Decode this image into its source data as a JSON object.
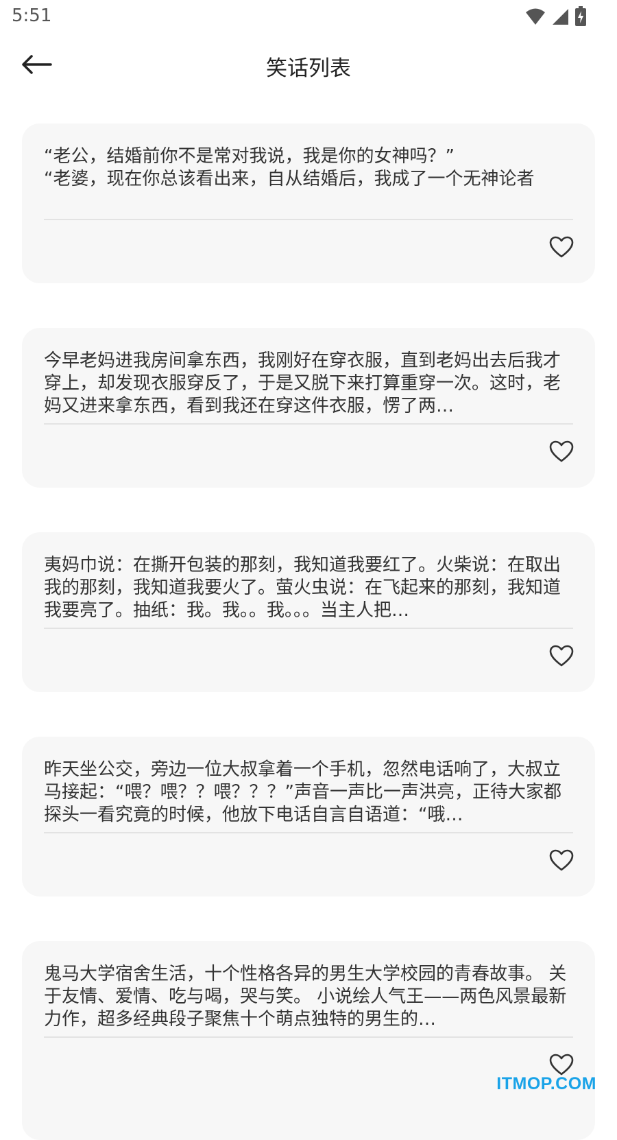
{
  "status_bar": {
    "time": "5:51",
    "icons": [
      "wifi-icon",
      "cellular-signal-icon",
      "battery-charging-icon"
    ]
  },
  "app_bar": {
    "back_icon": "arrow-left-icon",
    "title": "笑话列表"
  },
  "jokes": [
    {
      "text": "“老公，结婚前你不是常对我说，我是你的女神吗？”\n“老婆，现在你总该看出来，自从结婚后，我成了一个无神论者",
      "favorite_icon": "heart-outline-icon"
    },
    {
      "text": "今早老妈进我房间拿东西，我刚好在穿衣服，直到老妈出去后我才穿上，却发现衣服穿反了，于是又脱下来打算重穿一次。这时，老妈又进来拿东西，看到我还在穿这件衣服，愣了两…",
      "favorite_icon": "heart-outline-icon"
    },
    {
      "text": "夷妈巾说：在撕开包装的那刻，我知道我要红了。火柴说：在取出我的那刻，我知道我要火了。萤火虫说：在飞起来的那刻，我知道我要亮了。抽纸：我。我。。我。。。当主人把…",
      "favorite_icon": "heart-outline-icon"
    },
    {
      "text": "昨天坐公交，旁边一位大叔拿着一个手机，忽然电话响了，大叔立马接起：“喂？喂？？喂？？？”声音一声比一声洪亮，正待大家都探头一看究竟的时候，他放下电话自言自语道：“哦…",
      "favorite_icon": "heart-outline-icon"
    },
    {
      "text": "鬼马大学宿舍生活，十个性格各异的男生大学校园的青春故事。 关于友情、爱情、吃与喝，哭与笑。 小说绘人气王——两色风景最新力作，超多经典段子聚焦十个萌点独特的男生的…",
      "favorite_icon": "heart-outline-icon"
    }
  ],
  "watermark": "ITMOP.COM",
  "colors": {
    "card_background": "#f7f7f7",
    "divider": "#e3e3e3",
    "watermark": "#1aa3e8"
  }
}
